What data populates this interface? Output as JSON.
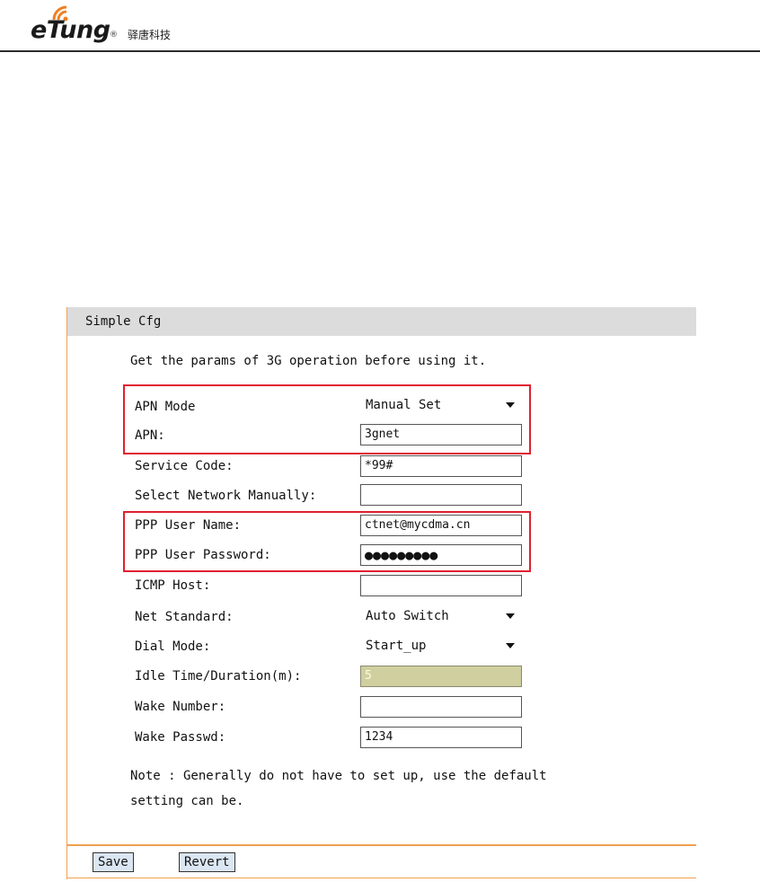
{
  "header": {
    "brand": "eTung",
    "registered_mark": "®",
    "brand_cn": "驿唐科技"
  },
  "panel": {
    "title": "Simple Cfg",
    "intro": "Get the params of 3G operation before using it.",
    "fields": {
      "apn_mode": {
        "label": "APN Mode",
        "value": "Manual Set"
      },
      "apn": {
        "label": "APN:",
        "value": "3gnet"
      },
      "service_code": {
        "label": "Service Code:",
        "value": "*99#"
      },
      "select_network": {
        "label": "Select Network Manually:",
        "value": ""
      },
      "ppp_user": {
        "label": "PPP User Name:",
        "value": "ctnet@mycdma.cn"
      },
      "ppp_password": {
        "label": "PPP User Password:",
        "value": "●●●●●●●●●"
      },
      "icmp_host": {
        "label": "ICMP Host:",
        "value": ""
      },
      "net_standard": {
        "label": "Net Standard:",
        "value": "Auto Switch"
      },
      "dial_mode": {
        "label": "Dial Mode:",
        "value": "Start_up"
      },
      "idle_time": {
        "label": "Idle Time/Duration(m):",
        "value": "5"
      },
      "wake_number": {
        "label": "Wake Number:",
        "value": ""
      },
      "wake_passwd": {
        "label": "Wake Passwd:",
        "value": "1234"
      }
    },
    "note": "Note : Generally do not have to set up, use the default\nsetting can be.",
    "buttons": {
      "save": "Save",
      "revert": "Revert"
    }
  },
  "colors": {
    "highlight": "#e02030",
    "panel_border": "#f0a050",
    "title_bar": "#dcdcdc",
    "button_bg": "#dbe6f3",
    "disabled_field": "#cfcf9f"
  }
}
